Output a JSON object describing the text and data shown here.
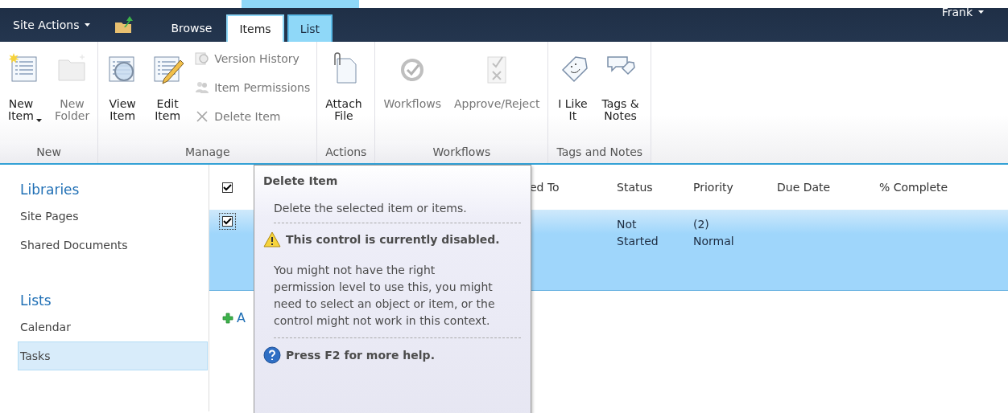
{
  "top_bar": {
    "site_actions": "Site Actions",
    "tabs": [
      {
        "label": "Browse",
        "selected": false,
        "kind": "standard"
      },
      {
        "label": "Items",
        "selected": true,
        "kind": "contextual"
      },
      {
        "label": "List",
        "selected": false,
        "kind": "contextual"
      }
    ],
    "user": "Frank"
  },
  "ribbon": {
    "groups": [
      {
        "label": "New",
        "buttons": [
          {
            "label": "New\nItem",
            "kind": "large",
            "disabled": false,
            "dropdown": true
          },
          {
            "label": "New\nFolder",
            "kind": "large",
            "disabled": true,
            "dropdown": false
          }
        ]
      },
      {
        "label": "Manage",
        "buttons": [
          {
            "label": "View\nItem",
            "kind": "large",
            "disabled": false,
            "dropdown": false
          },
          {
            "label": "Edit\nItem",
            "kind": "large",
            "disabled": false,
            "dropdown": false
          },
          {
            "label": "Version History",
            "kind": "small",
            "disabled": true,
            "dropdown": false
          },
          {
            "label": "Item Permissions",
            "kind": "small",
            "disabled": true,
            "dropdown": false
          },
          {
            "label": "Delete Item",
            "kind": "small",
            "disabled": true,
            "dropdown": false
          }
        ]
      },
      {
        "label": "Actions",
        "buttons": [
          {
            "label": "Attach\nFile",
            "kind": "large",
            "disabled": false,
            "dropdown": false
          }
        ]
      },
      {
        "label": "Workflows",
        "buttons": [
          {
            "label": "Workflows",
            "kind": "large",
            "disabled": true,
            "dropdown": false
          },
          {
            "label": "Approve/Reject",
            "kind": "large",
            "disabled": true,
            "dropdown": false
          }
        ]
      },
      {
        "label": "Tags and Notes",
        "buttons": [
          {
            "label": "I Like\nIt",
            "kind": "large",
            "disabled": false,
            "dropdown": false
          },
          {
            "label": "Tags &\nNotes",
            "kind": "large",
            "disabled": false,
            "dropdown": false
          }
        ]
      }
    ]
  },
  "sidebar": {
    "items": [
      {
        "label": "Libraries",
        "kind": "heading",
        "selected": false
      },
      {
        "label": "Site Pages",
        "kind": "link",
        "selected": false
      },
      {
        "label": "Shared Documents",
        "kind": "link",
        "selected": false
      },
      {
        "label": "Lists",
        "kind": "heading",
        "selected": false
      },
      {
        "label": "Calendar",
        "kind": "link",
        "selected": false
      },
      {
        "label": "Tasks",
        "kind": "link",
        "selected": true
      }
    ]
  },
  "table": {
    "select_all_checked": true,
    "columns": [
      "ed To",
      "Status",
      "Priority",
      "Due Date",
      "% Complete"
    ],
    "rows": [
      {
        "selected": true,
        "checked": true,
        "status": "Not\nStarted",
        "priority": "(2)\nNormal"
      }
    ]
  },
  "add_link": "A",
  "tooltip": {
    "title": "Delete Item",
    "description": "Delete the selected item or items.",
    "warning": "This control is currently disabled.",
    "explanation": "You might not have the right permission level to use this, you might need to select an object or item, or the control might not work in this context.",
    "help": "Press F2 for more help."
  }
}
